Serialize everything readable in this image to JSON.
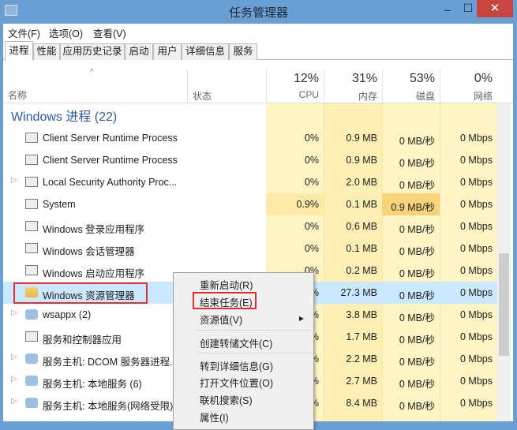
{
  "window": {
    "title": "任务管理器",
    "min": "–",
    "max": "☐",
    "close": "✕"
  },
  "menu": [
    "文件(F)",
    "选项(O)",
    "查看(V)"
  ],
  "tabs": [
    "进程",
    "性能",
    "应用历史记录",
    "启动",
    "用户",
    "详细信息",
    "服务"
  ],
  "header": {
    "name": "名称",
    "status": "状态",
    "cpu_pct": "12%",
    "cpu": "CPU",
    "mem_pct": "31%",
    "mem": "内存",
    "disk_pct": "53%",
    "disk": "磁盘",
    "net_pct": "0%",
    "net": "网络"
  },
  "group": "Windows 进程 (22)",
  "rows": [
    {
      "name": "Client Server Runtime Process",
      "cpu": "0%",
      "mem": "0.9 MB",
      "disk": "0 MB/秒",
      "net": "0 Mbps",
      "icon": "window",
      "exp": false
    },
    {
      "name": "Client Server Runtime Process",
      "cpu": "0%",
      "mem": "0.9 MB",
      "disk": "0 MB/秒",
      "net": "0 Mbps",
      "icon": "window",
      "exp": false
    },
    {
      "name": "Local Security Authority Proc...",
      "cpu": "0%",
      "mem": "2.0 MB",
      "disk": "0 MB/秒",
      "net": "0 Mbps",
      "icon": "window",
      "exp": true
    },
    {
      "name": "System",
      "cpu": "0.9%",
      "mem": "0.1 MB",
      "disk": "0.9 MB/秒",
      "net": "0 Mbps",
      "icon": "window",
      "exp": false
    },
    {
      "name": "Windows 登录应用程序",
      "cpu": "0%",
      "mem": "0.6 MB",
      "disk": "0 MB/秒",
      "net": "0 Mbps",
      "icon": "window",
      "exp": false
    },
    {
      "name": "Windows 会话管理器",
      "cpu": "0%",
      "mem": "0.1 MB",
      "disk": "0 MB/秒",
      "net": "0 Mbps",
      "icon": "window",
      "exp": false
    },
    {
      "name": "Windows 启动应用程序",
      "cpu": "0%",
      "mem": "0.2 MB",
      "disk": "0 MB/秒",
      "net": "0 Mbps",
      "icon": "window",
      "exp": false
    },
    {
      "name": "Windows 资源管理器",
      "cpu": "%",
      "mem": "27.3 MB",
      "disk": "0 MB/秒",
      "net": "0 Mbps",
      "icon": "folder",
      "exp": false,
      "selected": true
    },
    {
      "name": "wsappx (2)",
      "cpu": "%",
      "mem": "3.8 MB",
      "disk": "0 MB/秒",
      "net": "0 Mbps",
      "icon": "gear",
      "exp": true
    },
    {
      "name": "服务和控制器应用",
      "cpu": "%",
      "mem": "1.7 MB",
      "disk": "0 MB/秒",
      "net": "0 Mbps",
      "icon": "window",
      "exp": false
    },
    {
      "name": "服务主机: DCOM 服务器进程...",
      "cpu": "%",
      "mem": "2.2 MB",
      "disk": "0 MB/秒",
      "net": "0 Mbps",
      "icon": "gear",
      "exp": true
    },
    {
      "name": "服务主机: 本地服务 (6)",
      "cpu": "%",
      "mem": "2.7 MB",
      "disk": "0 MB/秒",
      "net": "0 Mbps",
      "icon": "gear",
      "exp": true
    },
    {
      "name": "服务主机: 本地服务(网络受限)",
      "cpu": "%",
      "mem": "8.4 MB",
      "disk": "0 MB/秒",
      "net": "0 Mbps",
      "icon": "gear",
      "exp": true
    }
  ],
  "context_menu": [
    {
      "label": "重新启动(R)"
    },
    {
      "label": "结束任务(E)",
      "highlighted": true
    },
    {
      "label": "资源值(V)",
      "submenu": true
    },
    {
      "sep": true
    },
    {
      "label": "创建转储文件(C)"
    },
    {
      "sep": true
    },
    {
      "label": "转到详细信息(G)"
    },
    {
      "label": "打开文件位置(O)"
    },
    {
      "label": "联机搜索(S)"
    },
    {
      "label": "属性(I)"
    }
  ],
  "colors": {
    "accent": "#e2312f",
    "tint": "#fff4c4",
    "selected": "#cce8ff"
  }
}
